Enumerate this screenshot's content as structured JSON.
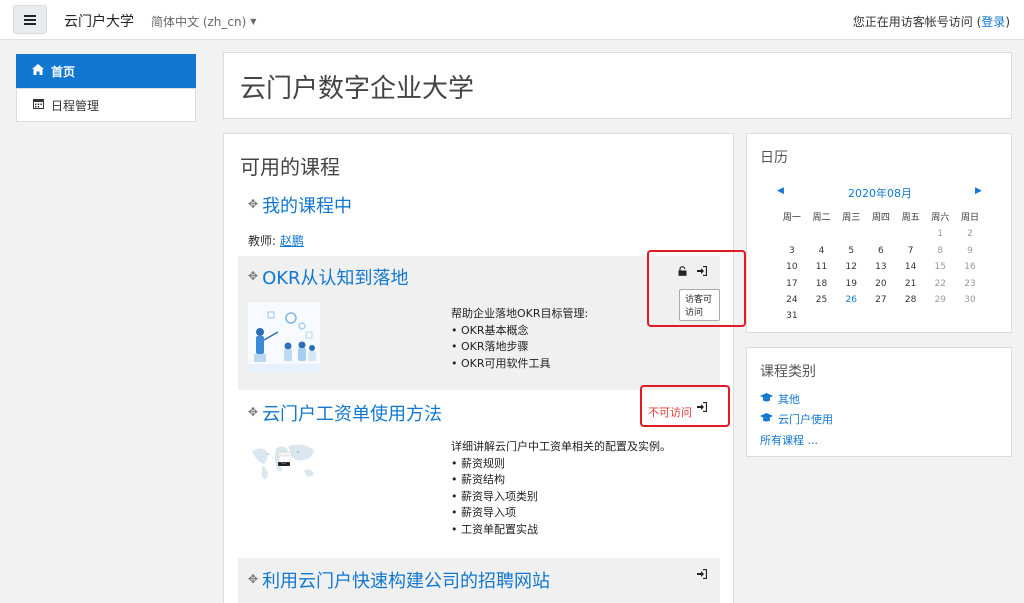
{
  "navbar": {
    "site_name": "云门户大学",
    "language": "简体中文 (zh_cn)",
    "login_text": "您正在用访客帐号访问 (",
    "login_link": "登录",
    "login_close": ")"
  },
  "sidebar": {
    "items": [
      {
        "label": "首页",
        "icon": "home-icon"
      },
      {
        "label": "日程管理",
        "icon": "calendar-icon"
      }
    ]
  },
  "page": {
    "title": "云门户数字企业大学"
  },
  "main": {
    "title": "可用的课程",
    "courses": [
      {
        "name": "我的课程中",
        "teacher_label": "教师: ",
        "teacher_name": "赵鹏"
      },
      {
        "name": "OKR从认知到落地",
        "tooltip": "访客可访问",
        "summary_intro": "帮助企业落地OKR目标管理:",
        "summary_items": [
          "OKR基本概念",
          "OKR落地步骤",
          "OKR可用软件工具"
        ]
      },
      {
        "name": "云门户工资单使用方法",
        "access_status": "不可访问",
        "summary_intro": "详细讲解云门户中工资单相关的配置及实例。",
        "summary_items": [
          "薪资规则",
          "薪资结构",
          "薪资导入项类别",
          "薪资导入项",
          "工资单配置实战"
        ]
      },
      {
        "name": "利用云门户快速构建公司的招聘网站"
      }
    ]
  },
  "calendar": {
    "title": "日历",
    "month": "2020年08月",
    "weekdays": [
      "周一",
      "周二",
      "周三",
      "周四",
      "周五",
      "周六",
      "周日"
    ],
    "weeks": [
      [
        "",
        "",
        "",
        "",
        "",
        "1",
        "2"
      ],
      [
        "3",
        "4",
        "5",
        "6",
        "7",
        "8",
        "9"
      ],
      [
        "10",
        "11",
        "12",
        "13",
        "14",
        "15",
        "16"
      ],
      [
        "17",
        "18",
        "19",
        "20",
        "21",
        "22",
        "23"
      ],
      [
        "24",
        "25",
        "26",
        "27",
        "28",
        "29",
        "30"
      ],
      [
        "31",
        "",
        "",
        "",
        "",
        "",
        ""
      ]
    ],
    "today": "26"
  },
  "categories": {
    "title": "课程类别",
    "items": [
      "其他",
      "云门户使用"
    ],
    "all_courses": "所有课程 ..."
  },
  "colors": {
    "accent": "#1177d1",
    "highlight_red": "#e01b24",
    "no_access_red": "#e53935"
  }
}
